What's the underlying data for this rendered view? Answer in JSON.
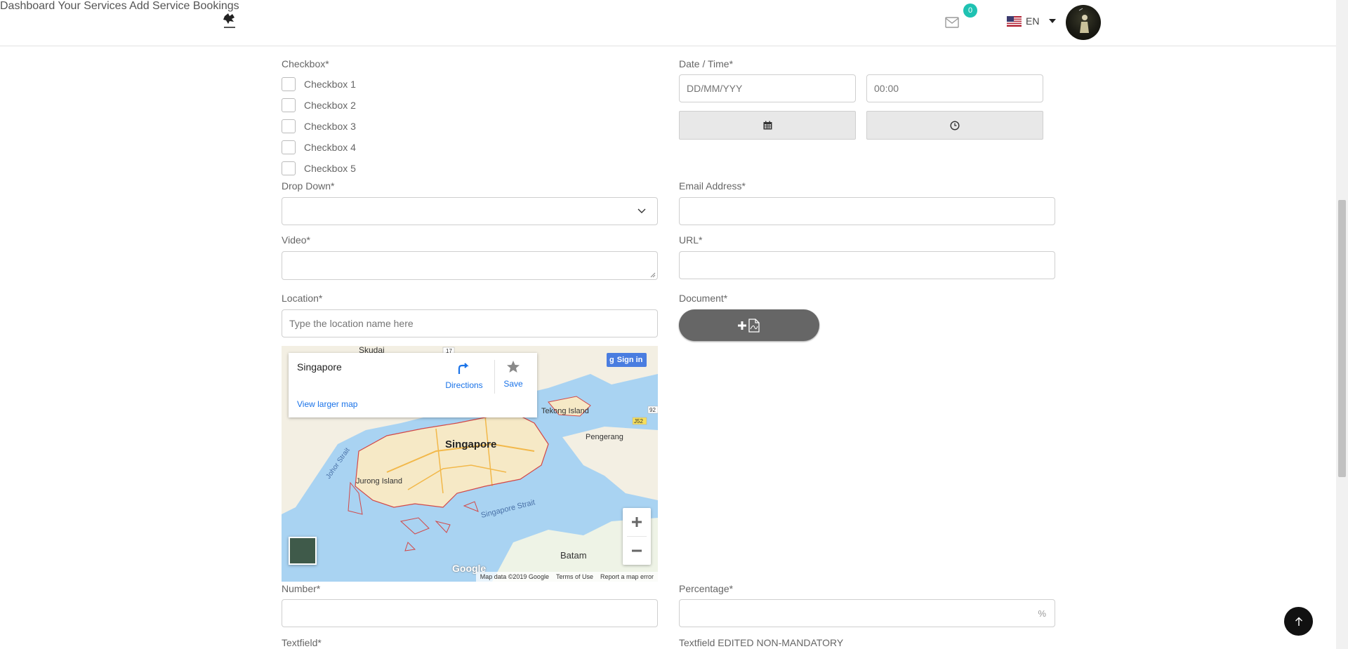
{
  "header": {
    "nav": [
      "Dashboard",
      "Your Services",
      "Add Service",
      "Bookings"
    ],
    "mail_count": "0",
    "language": "EN",
    "logo_icon": "dragon-logo-icon",
    "mail_icon": "mail-icon",
    "language_flag_icon": "uk-flag-icon"
  },
  "form": {
    "checkbox": {
      "label": "Checkbox*",
      "options": [
        "Checkbox 1",
        "Checkbox 2",
        "Checkbox 3",
        "Checkbox 4",
        "Checkbox 5"
      ]
    },
    "datetime": {
      "label": "Date / Time*",
      "date_placeholder": "DD/MM/YYY",
      "time_placeholder": "00:00",
      "calendar_icon": "calendar-icon",
      "clock_icon": "clock-icon"
    },
    "dropdown": {
      "label": "Drop Down*",
      "value": ""
    },
    "email": {
      "label": "Email Address*",
      "value": ""
    },
    "video": {
      "label": "Video*",
      "value": ""
    },
    "url": {
      "label": "URL*",
      "value": ""
    },
    "location": {
      "label": "Location*",
      "placeholder": "Type the location name here"
    },
    "document": {
      "label": "Document*",
      "icon": "add-pdf-icon"
    },
    "number": {
      "label": "Number*",
      "value": ""
    },
    "percentage": {
      "label": "Percentage*",
      "suffix": "%"
    },
    "textfield": {
      "label": "Textfield*"
    },
    "textfield_edited": {
      "label": "Textfield EDITED NON-MANDATORY"
    }
  },
  "map": {
    "place": "Singapore",
    "directions": "Directions",
    "save": "Save",
    "view_larger": "View larger map",
    "sign_in": "Sign in",
    "labels": {
      "singapore": "Singapore",
      "skudai": "Skudai",
      "tekong": "Tekong Island",
      "pengerang": "Pengerang",
      "jurong": "Jurong Island",
      "johor_strait": "Johor Strait",
      "singapore_strait": "Singapore Strait",
      "batam": "Batam",
      "r17": "17",
      "r92": "92",
      "j52": "J52"
    },
    "brand": "Google",
    "attribution": [
      "Map data ©2019 Google",
      "Terms of Use",
      "Report a map error"
    ]
  },
  "scroll_top_icon": "arrow-up-icon"
}
